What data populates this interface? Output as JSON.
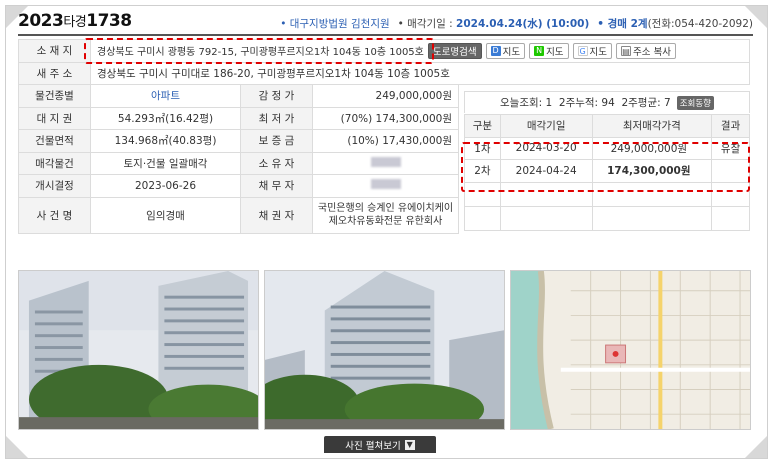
{
  "header": {
    "case_year": "2023",
    "case_type": "타경",
    "case_num": "1738",
    "court": "• 대구지방법원 김천지원",
    "sale_label": "• 매각기일 : ",
    "sale_date": "2024.04.24(水) (10:00)",
    "dept_label": "• 경매 2계",
    "dept_phone": "(전화:054-420-2092)"
  },
  "table": {
    "address_label": "소 재 지",
    "address": "경상북도 구미시 광평동 792-15, 구미광평푸르지오1차 104동 10층 1005호",
    "new_address_label": "새 주 소",
    "new_address": "경상북도 구미시 구미대로 186-20, 구미광평푸르지오1차 104동 10층 1005호",
    "buttons": {
      "road": "도로명검색",
      "daum": "지도",
      "naver": "지도",
      "google": "지도",
      "copy": "주소 복사"
    },
    "rows": [
      {
        "l1": "물건종별",
        "v1": "아파트",
        "l2": "감 정 가",
        "v2": "249,000,000원"
      },
      {
        "l1": "대 지 권",
        "v1": "54.293㎡(16.42평)",
        "l2": "최 저 가",
        "v2": "(70%) 174,300,000원"
      },
      {
        "l1": "건물면적",
        "v1": "134.968㎡(40.83평)",
        "l2": "보 증 금",
        "v2": "(10%) 17,430,000원"
      },
      {
        "l1": "매각물건",
        "v1": "토지·건물 일괄매각",
        "l2": "소 유 자",
        "v2": ""
      },
      {
        "l1": "개시결정",
        "v1": "2023-06-26",
        "l2": "채 무 자",
        "v2": ""
      },
      {
        "l1": "사 건 명",
        "v1": "임의경매",
        "l2": "채 권 자",
        "v2": "국민은행의 승계인 유에이치케이\n제오차유동화전문 유한회사"
      }
    ]
  },
  "stats": {
    "text": "오늘조회: 1  2주누적: 94  2주평균: 7",
    "button": "조회동향"
  },
  "history": {
    "headers": [
      "구분",
      "매각기일",
      "최저매각가격",
      "결과"
    ],
    "rows": [
      {
        "round": "1차",
        "date": "2024-03-20",
        "price": "249,000,000원",
        "result": "유찰"
      },
      {
        "round": "2차",
        "date": "2024-04-24",
        "price": "174,300,000원",
        "result": ""
      }
    ]
  },
  "photo_button": "사진 펼쳐보기",
  "colors": {
    "accent_blue": "#2b5fb3",
    "highlight_red": "#e00000"
  }
}
